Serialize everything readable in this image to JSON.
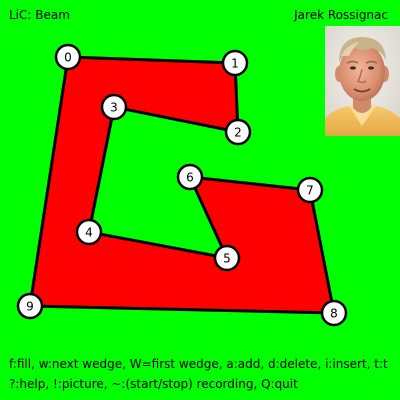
{
  "app": {
    "title": "LiC: Beam",
    "author": "Jarek Rossignac"
  },
  "photo": {
    "icon": "author-portrait"
  },
  "polygon": {
    "fill": "#ff0000",
    "stroke": "#000000",
    "vertex_fill": "#ffffff",
    "vertex_labels": [
      "0",
      "1",
      "2",
      "3",
      "4",
      "5",
      "6",
      "7",
      "8",
      "9"
    ]
  },
  "help": {
    "line1": "f:fill, w:next wedge, W=first wedge, a:add, d:delete, i:insert, t:t",
    "line2": "?:help, !:picture, ~:(start/stop) recording, Q:quit"
  },
  "colors": {
    "background": "#00ff00",
    "shape": "#ff0000"
  }
}
